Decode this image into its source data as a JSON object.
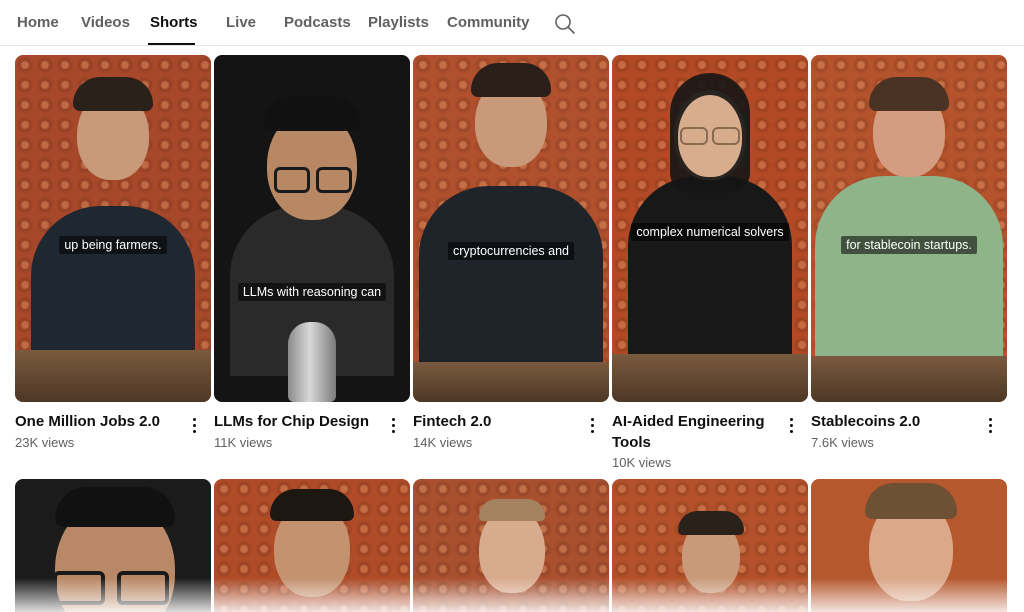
{
  "tabs": {
    "home": "Home",
    "videos": "Videos",
    "shorts": "Shorts",
    "live": "Live",
    "podcasts": "Podcasts",
    "playlists": "Playlists",
    "community": "Community",
    "search_icon": "search-icon",
    "active": "Shorts"
  },
  "shorts_row1": [
    {
      "title": "One Million Jobs 2.0",
      "views": "23K views",
      "caption": "up being farmers."
    },
    {
      "title": "LLMs for Chip Design",
      "views": "11K views",
      "caption": "LLMs with reasoning can"
    },
    {
      "title": "Fintech 2.0",
      "views": "14K views",
      "caption": "cryptocurrencies and"
    },
    {
      "title": "AI-Aided Engineering Tools",
      "title_line1": "AI-Aided Engineering",
      "title_line2": "Tools",
      "views": "10K views",
      "caption": "complex numerical solvers"
    },
    {
      "title": "Stablecoins 2.0",
      "views": "7.6K views",
      "caption": "for stablecoin startups."
    }
  ],
  "icons": {
    "more": "more-vert-icon"
  },
  "colors": {
    "active_tab": "#0f0f0f",
    "inactive_tab": "#606060",
    "views_text": "#606060",
    "divider": "#e5e5e5"
  }
}
